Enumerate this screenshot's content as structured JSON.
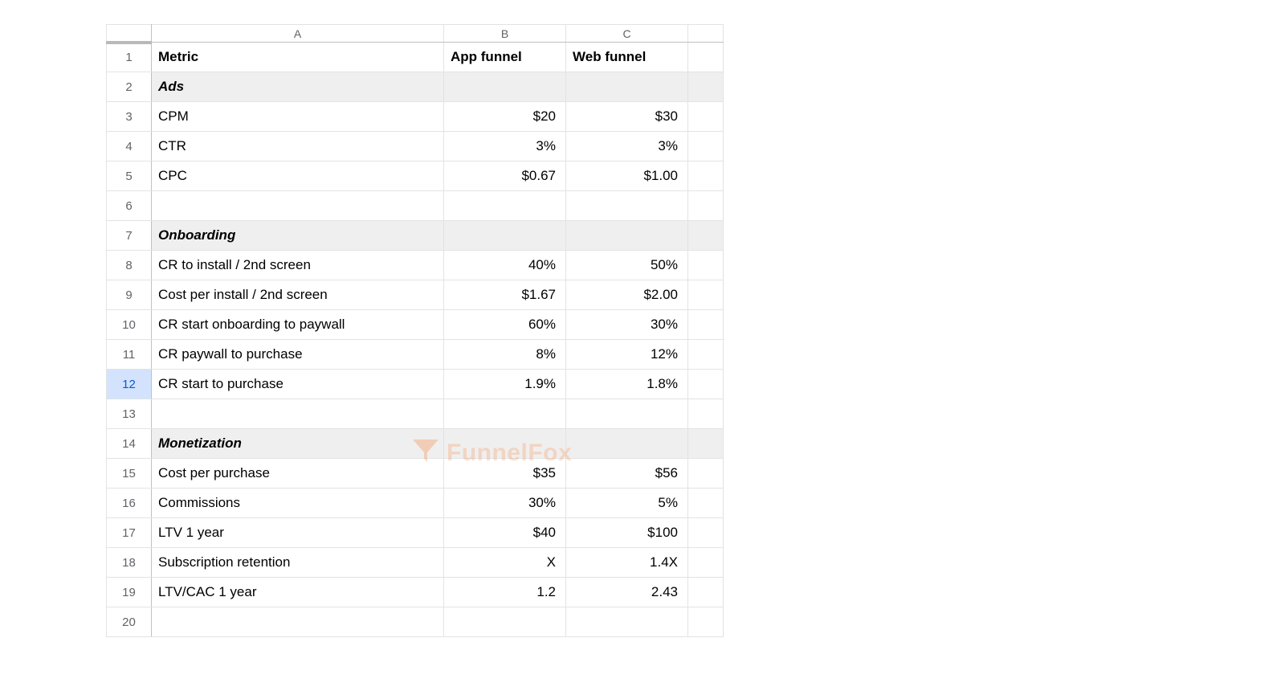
{
  "columns": {
    "A": "A",
    "B": "B",
    "C": "C"
  },
  "header": {
    "metric": "Metric",
    "app": "App funnel",
    "web": "Web funnel"
  },
  "sections": {
    "ads": "Ads",
    "onboarding": "Onboarding",
    "monetization": "Monetization"
  },
  "rows": {
    "cpm": {
      "label": "CPM",
      "app": "$20",
      "web": "$30"
    },
    "ctr": {
      "label": "CTR",
      "app": "3%",
      "web": "3%"
    },
    "cpc": {
      "label": "CPC",
      "app": "$0.67",
      "web": "$1.00"
    },
    "cr_install": {
      "label": "CR to install / 2nd screen",
      "app": "40%",
      "web": "50%"
    },
    "cost_install": {
      "label": "Cost per install / 2nd screen",
      "app": "$1.67",
      "web": "$2.00"
    },
    "cr_paywall": {
      "label": "CR start onboarding to paywall",
      "app": "60%",
      "web": "30%"
    },
    "cr_purchase": {
      "label": "CR paywall to purchase",
      "app": "8%",
      "web": "12%"
    },
    "cr_start": {
      "label": "CR start to purchase",
      "app": "1.9%",
      "web": "1.8%"
    },
    "cost_purchase": {
      "label": "Cost per purchase",
      "app": "$35",
      "web": "$56"
    },
    "commissions": {
      "label": "Commissions",
      "app": "30%",
      "web": "5%"
    },
    "ltv": {
      "label": "LTV 1 year",
      "app": "$40",
      "web": "$100"
    },
    "retention": {
      "label": "Subscription retention",
      "app": "X",
      "web": "1.4X"
    },
    "ltv_cac": {
      "label": "LTV/CAC 1 year",
      "app": "1.2",
      "web": "2.43"
    }
  },
  "row_numbers": {
    "1": "1",
    "2": "2",
    "3": "3",
    "4": "4",
    "5": "5",
    "6": "6",
    "7": "7",
    "8": "8",
    "9": "9",
    "10": "10",
    "11": "11",
    "12": "12",
    "13": "13",
    "14": "14",
    "15": "15",
    "16": "16",
    "17": "17",
    "18": "18",
    "19": "19",
    "20": "20"
  },
  "selected_row": "12",
  "watermark": "FunnelFox"
}
